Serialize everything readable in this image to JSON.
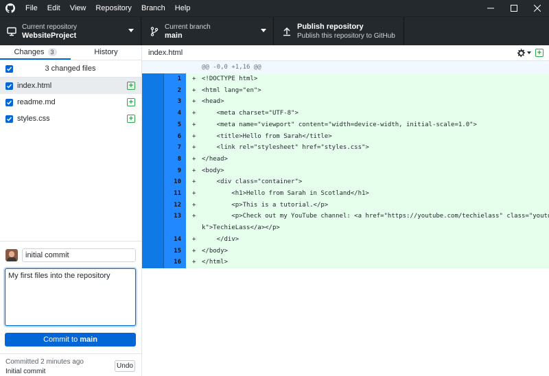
{
  "menu": [
    "File",
    "Edit",
    "View",
    "Repository",
    "Branch",
    "Help"
  ],
  "toolbar": {
    "repo_label": "Current repository",
    "repo_value": "WebsiteProject",
    "branch_label": "Current branch",
    "branch_value": "main",
    "publish_title": "Publish repository",
    "publish_desc": "Publish this repository to GitHub"
  },
  "tabs": {
    "changes": "Changes",
    "changes_count": "3",
    "history": "History"
  },
  "changes_header": "3 changed files",
  "files": [
    "index.html",
    "readme.md",
    "styles.css"
  ],
  "commit": {
    "summary": "initial commit",
    "description": "My first files into the repository",
    "button_prefix": "Commit to ",
    "button_branch": "main"
  },
  "last_commit": {
    "time": "Committed 2 minutes ago",
    "message": "Initial commit",
    "undo": "Undo"
  },
  "diff": {
    "filename": "index.html",
    "hunk": "@@ -0,0 +1,16 @@",
    "lines": [
      {
        "n": "1",
        "code": "<!DOCTYPE html>"
      },
      {
        "n": "2",
        "code": "<html lang=\"en\">"
      },
      {
        "n": "3",
        "code": "<head>"
      },
      {
        "n": "4",
        "code": "    <meta charset=\"UTF-8\">"
      },
      {
        "n": "5",
        "code": "    <meta name=\"viewport\" content=\"width=device-width, initial-scale=1.0\">"
      },
      {
        "n": "6",
        "code": "    <title>Hello from Sarah</title>"
      },
      {
        "n": "7",
        "code": "    <link rel=\"stylesheet\" href=\"styles.css\">"
      },
      {
        "n": "8",
        "code": "</head>"
      },
      {
        "n": "9",
        "code": "<body>"
      },
      {
        "n": "10",
        "code": "    <div class=\"container\">"
      },
      {
        "n": "11",
        "code": "        <h1>Hello from Sarah in Scotland</h1>"
      },
      {
        "n": "12",
        "code": "        <p>This is a tutorial.</p>"
      },
      {
        "n": "13",
        "code": "        <p>Check out my YouTube channel: <a href=\"https://youtube.com/techielass\" class=\"youtube-lin"
      },
      {
        "n": "",
        "code": "k\">TechieLass</a></p>"
      },
      {
        "n": "14",
        "code": "    </div>"
      },
      {
        "n": "15",
        "code": "</body>"
      },
      {
        "n": "16",
        "code": "</html>"
      }
    ]
  },
  "colors": {
    "accent": "#0366d6",
    "titlebar": "#24292e",
    "added_bg": "#e6ffed",
    "gutter": "#2188ff"
  }
}
